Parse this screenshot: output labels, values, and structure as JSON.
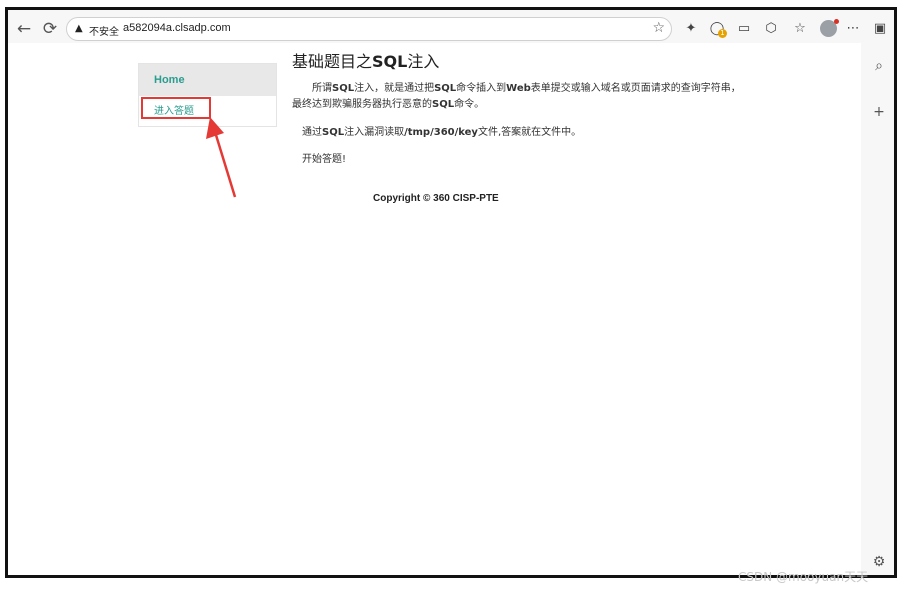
{
  "browser": {
    "back_glyph": "←",
    "reload_glyph": "⟳",
    "security_label": "不安全",
    "url": "a582094a.clsadp.com",
    "badge_count": "1"
  },
  "page": {
    "menu": {
      "home": "Home",
      "answer": "进入答题"
    },
    "title_prefix": "基础题目之",
    "title_bold": "SQL",
    "title_suffix": "注入",
    "p1_a": "所谓",
    "p1_b": "SQL",
    "p1_c": "注入，就是通过把",
    "p1_d": "SQL",
    "p1_e": "命令插入到",
    "p1_f": "Web",
    "p1_g": "表单提交或输入域名或页面请求的查询字符串，最终达到欺骗服务器执行恶意的",
    "p1_h": "SQL",
    "p1_i": "命令。",
    "p2_a": "通过",
    "p2_b": "SQL",
    "p2_c": "注入漏洞读取",
    "p2_d": "/tmp/360/key",
    "p2_e": "文件,答案就在文件中。",
    "p3": "开始答题!",
    "copyright": "Copyright © 360 CISP-PTE"
  },
  "watermark": "CSDN @mooyuan天天",
  "colors": {
    "accent": "#2a9d8f",
    "highlight": "#e53935"
  }
}
